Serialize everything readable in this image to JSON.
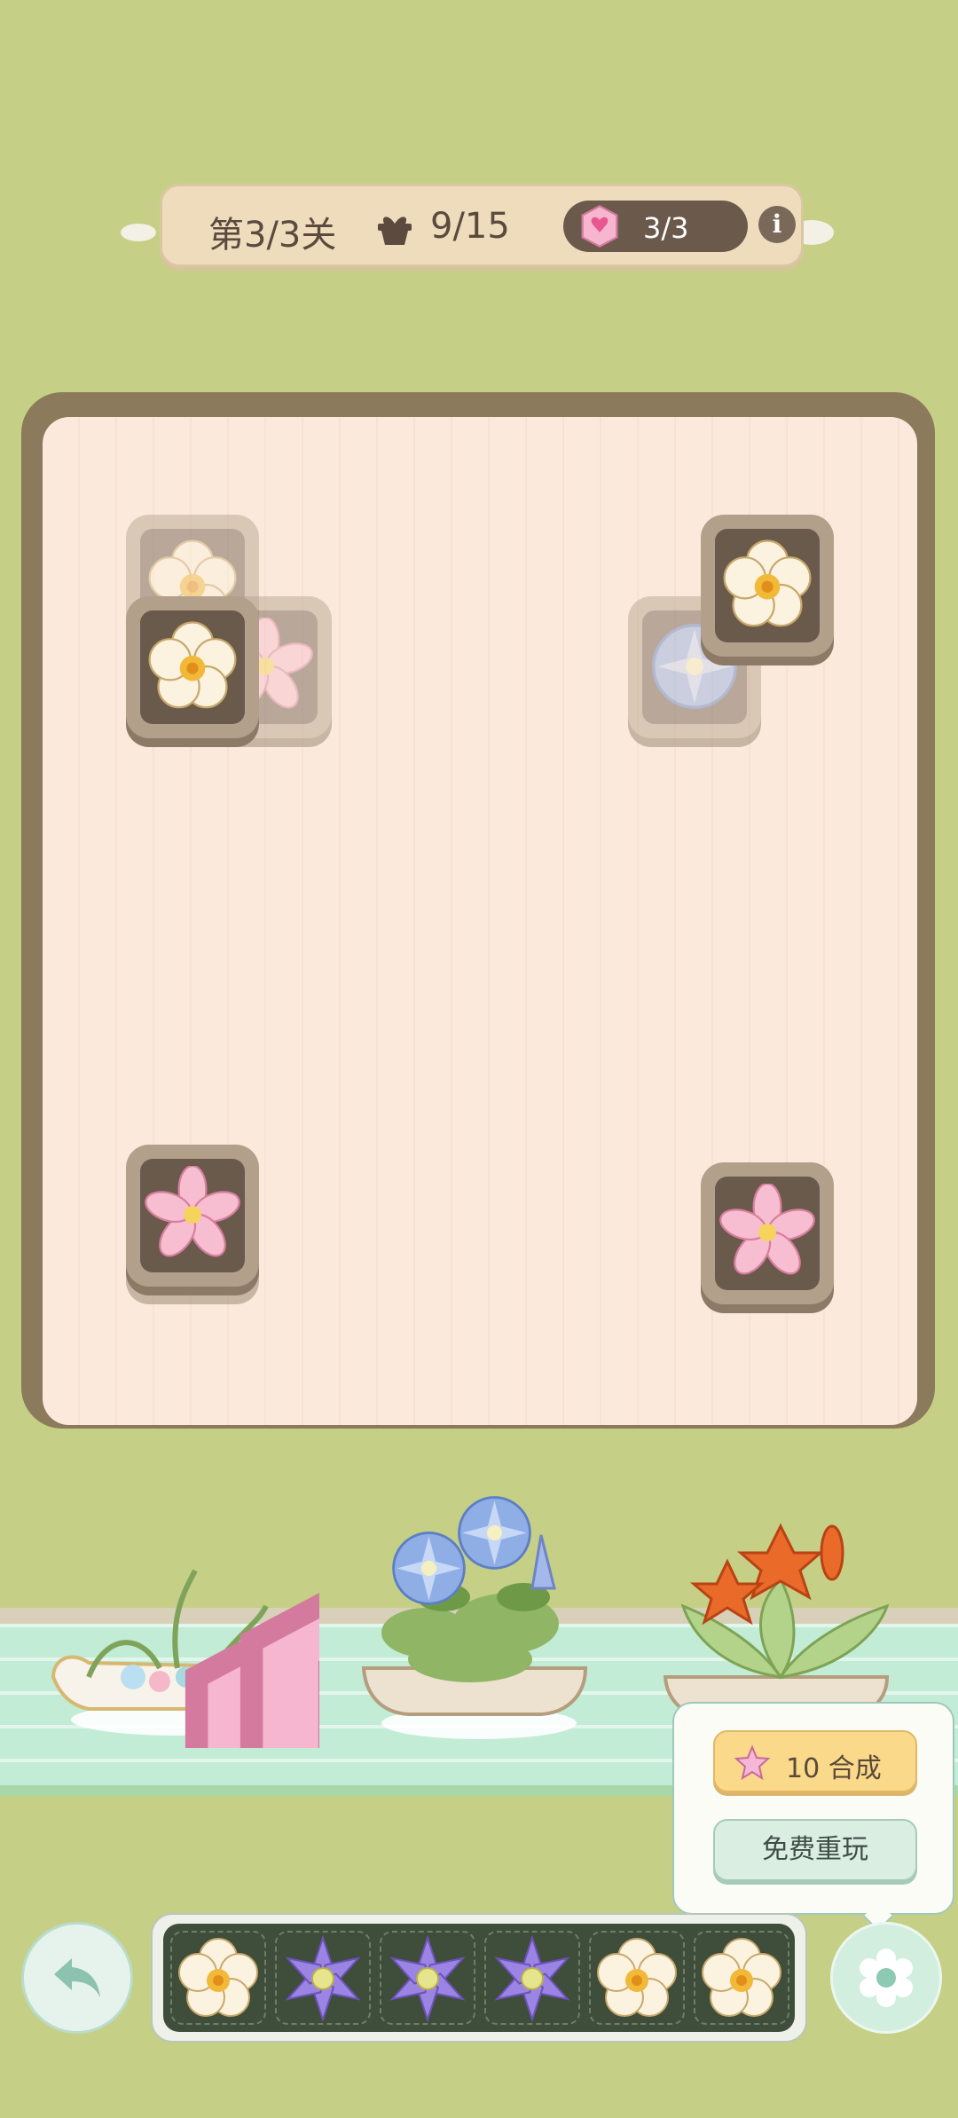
{
  "header": {
    "level_text": "第3/3关",
    "progress_text": "9/15",
    "gem_count": "3/3",
    "info_label": "i"
  },
  "board": {
    "tiles": [
      {
        "flower": "white-flower-icon",
        "state": "blocked"
      },
      {
        "flower": "pink-flower-icon",
        "state": "blocked"
      },
      {
        "flower": "white-flower-icon",
        "state": "active"
      },
      {
        "flower": "blue-flower-icon",
        "state": "blocked"
      },
      {
        "flower": "white-flower-icon",
        "state": "active"
      },
      {
        "flower": "pink-flower-icon",
        "state": "active"
      },
      {
        "flower": "pink-flower-icon",
        "state": "active"
      }
    ]
  },
  "river": {
    "boats": [
      "crystal-heart-flower-boat",
      "blue-flower-boat",
      "orange-lily-boat"
    ]
  },
  "popup": {
    "merge_cost": "10",
    "merge_label": "合成",
    "replay_label": "免费重玩"
  },
  "tray": {
    "slots": [
      "white-flower-icon",
      "purple-flower-icon",
      "purple-flower-icon",
      "purple-flower-icon",
      "white-flower-icon",
      "white-flower-icon"
    ]
  },
  "colors": {
    "background": "#c6cf86",
    "board": "#fbeadb",
    "tile": "#6a5a4c",
    "merge_button": "#fbd98b",
    "replay_button": "#dbeee2"
  }
}
